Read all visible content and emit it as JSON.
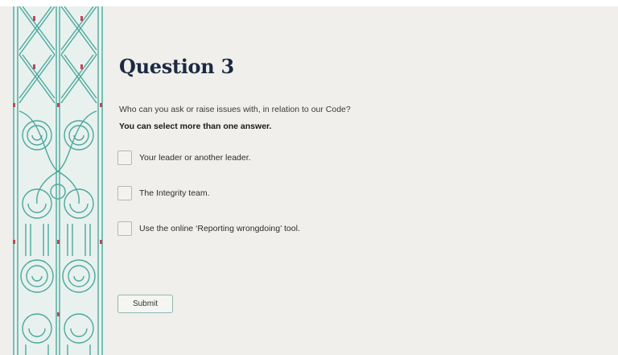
{
  "quiz": {
    "title": "Question 3",
    "question": "Who can you ask or raise issues with, in relation to our Code?",
    "hint": "You can select more than one answer.",
    "options": [
      {
        "label": "Your leader or another leader.",
        "checked": false
      },
      {
        "label": "The Integrity team.",
        "checked": false
      },
      {
        "label": "Use the online ‘Reporting wrongdoing’ tool.",
        "checked": false
      }
    ],
    "submit_label": "Submit"
  },
  "banner": {
    "pattern": "kowhaiwhai-koru-pattern"
  },
  "colors": {
    "background": "#f0efeb",
    "title": "#1c2a43",
    "banner_teal": "#4ba89e",
    "banner_red": "#c0455a",
    "button_border": "#8fb7b3"
  }
}
